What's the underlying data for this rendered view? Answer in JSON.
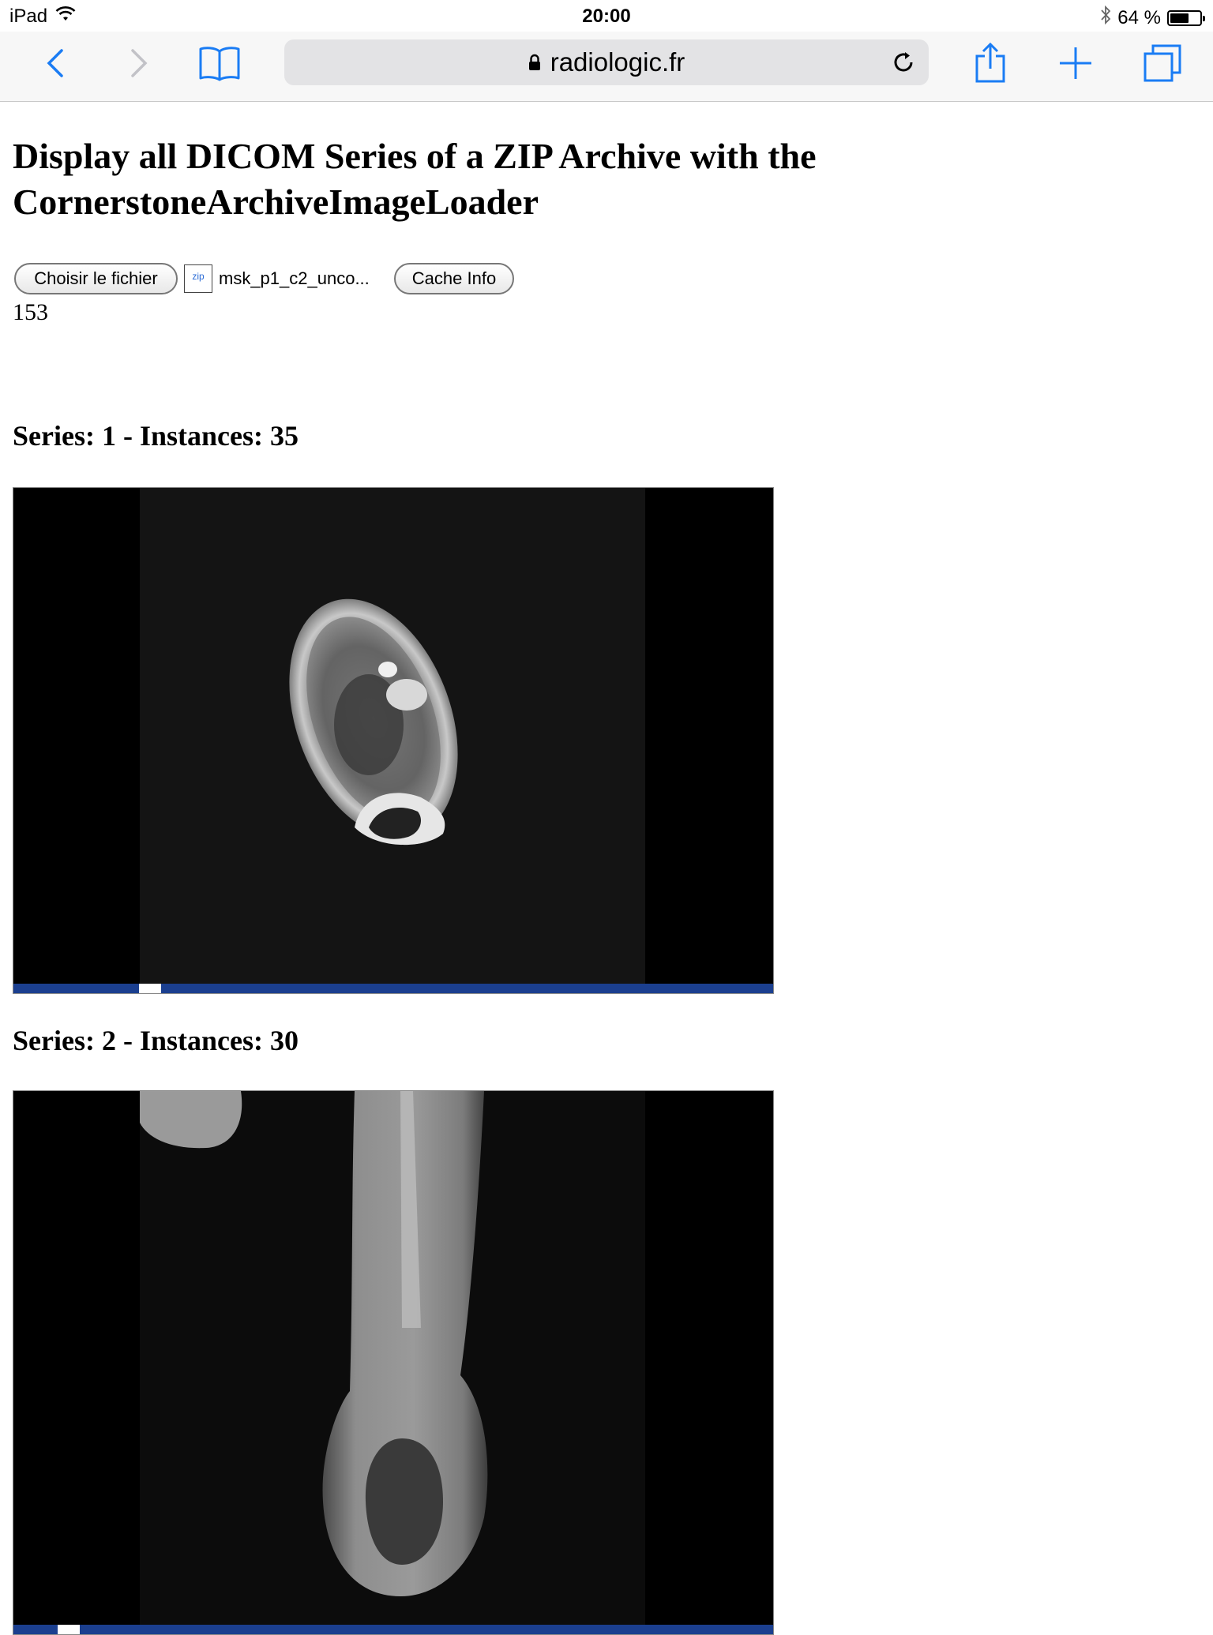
{
  "status_bar": {
    "device": "iPad",
    "time": "20:00",
    "battery_text": "64 %",
    "battery_level": 0.64,
    "wifi_icon": "wifi-icon",
    "bluetooth_icon": "bluetooth-icon"
  },
  "toolbar": {
    "url": "radiologic.fr",
    "icons": [
      "back-icon",
      "forward-icon",
      "bookmarks-icon",
      "lock-icon",
      "reload-icon",
      "share-icon",
      "new-tab-icon",
      "tabs-icon"
    ]
  },
  "page": {
    "title": "Display all DICOM Series of a ZIP Archive with the CornerstoneArchiveImageLoader",
    "choose_file_label": "Choisir le fichier",
    "zip_badge": "zip",
    "file_name": "msk_p1_c2_unco...",
    "cache_info_label": "Cache Info",
    "count": "153"
  },
  "series": [
    {
      "heading": "Series: 1 - Instances: 35",
      "scroll_position": 0.17
    },
    {
      "heading": "Series: 2 - Instances: 30",
      "scroll_position": 0.06
    }
  ],
  "colors": {
    "accent": "#1a7cf4",
    "scrollbar": "#1b3f8f",
    "scroll_thumb": "#ffffff"
  }
}
